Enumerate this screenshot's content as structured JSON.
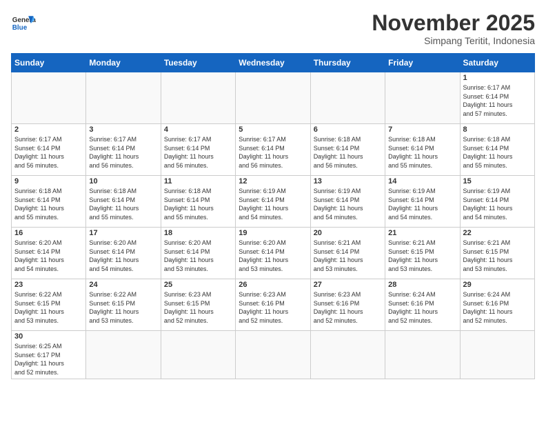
{
  "header": {
    "logo_general": "General",
    "logo_blue": "Blue",
    "month": "November 2025",
    "location": "Simpang Teritit, Indonesia"
  },
  "days_of_week": [
    "Sunday",
    "Monday",
    "Tuesday",
    "Wednesday",
    "Thursday",
    "Friday",
    "Saturday"
  ],
  "weeks": [
    [
      {
        "day": "",
        "info": ""
      },
      {
        "day": "",
        "info": ""
      },
      {
        "day": "",
        "info": ""
      },
      {
        "day": "",
        "info": ""
      },
      {
        "day": "",
        "info": ""
      },
      {
        "day": "",
        "info": ""
      },
      {
        "day": "1",
        "info": "Sunrise: 6:17 AM\nSunset: 6:14 PM\nDaylight: 11 hours\nand 57 minutes."
      }
    ],
    [
      {
        "day": "2",
        "info": "Sunrise: 6:17 AM\nSunset: 6:14 PM\nDaylight: 11 hours\nand 56 minutes."
      },
      {
        "day": "3",
        "info": "Sunrise: 6:17 AM\nSunset: 6:14 PM\nDaylight: 11 hours\nand 56 minutes."
      },
      {
        "day": "4",
        "info": "Sunrise: 6:17 AM\nSunset: 6:14 PM\nDaylight: 11 hours\nand 56 minutes."
      },
      {
        "day": "5",
        "info": "Sunrise: 6:17 AM\nSunset: 6:14 PM\nDaylight: 11 hours\nand 56 minutes."
      },
      {
        "day": "6",
        "info": "Sunrise: 6:18 AM\nSunset: 6:14 PM\nDaylight: 11 hours\nand 56 minutes."
      },
      {
        "day": "7",
        "info": "Sunrise: 6:18 AM\nSunset: 6:14 PM\nDaylight: 11 hours\nand 55 minutes."
      },
      {
        "day": "8",
        "info": "Sunrise: 6:18 AM\nSunset: 6:14 PM\nDaylight: 11 hours\nand 55 minutes."
      }
    ],
    [
      {
        "day": "9",
        "info": "Sunrise: 6:18 AM\nSunset: 6:14 PM\nDaylight: 11 hours\nand 55 minutes."
      },
      {
        "day": "10",
        "info": "Sunrise: 6:18 AM\nSunset: 6:14 PM\nDaylight: 11 hours\nand 55 minutes."
      },
      {
        "day": "11",
        "info": "Sunrise: 6:18 AM\nSunset: 6:14 PM\nDaylight: 11 hours\nand 55 minutes."
      },
      {
        "day": "12",
        "info": "Sunrise: 6:19 AM\nSunset: 6:14 PM\nDaylight: 11 hours\nand 54 minutes."
      },
      {
        "day": "13",
        "info": "Sunrise: 6:19 AM\nSunset: 6:14 PM\nDaylight: 11 hours\nand 54 minutes."
      },
      {
        "day": "14",
        "info": "Sunrise: 6:19 AM\nSunset: 6:14 PM\nDaylight: 11 hours\nand 54 minutes."
      },
      {
        "day": "15",
        "info": "Sunrise: 6:19 AM\nSunset: 6:14 PM\nDaylight: 11 hours\nand 54 minutes."
      }
    ],
    [
      {
        "day": "16",
        "info": "Sunrise: 6:20 AM\nSunset: 6:14 PM\nDaylight: 11 hours\nand 54 minutes."
      },
      {
        "day": "17",
        "info": "Sunrise: 6:20 AM\nSunset: 6:14 PM\nDaylight: 11 hours\nand 54 minutes."
      },
      {
        "day": "18",
        "info": "Sunrise: 6:20 AM\nSunset: 6:14 PM\nDaylight: 11 hours\nand 53 minutes."
      },
      {
        "day": "19",
        "info": "Sunrise: 6:20 AM\nSunset: 6:14 PM\nDaylight: 11 hours\nand 53 minutes."
      },
      {
        "day": "20",
        "info": "Sunrise: 6:21 AM\nSunset: 6:14 PM\nDaylight: 11 hours\nand 53 minutes."
      },
      {
        "day": "21",
        "info": "Sunrise: 6:21 AM\nSunset: 6:15 PM\nDaylight: 11 hours\nand 53 minutes."
      },
      {
        "day": "22",
        "info": "Sunrise: 6:21 AM\nSunset: 6:15 PM\nDaylight: 11 hours\nand 53 minutes."
      }
    ],
    [
      {
        "day": "23",
        "info": "Sunrise: 6:22 AM\nSunset: 6:15 PM\nDaylight: 11 hours\nand 53 minutes."
      },
      {
        "day": "24",
        "info": "Sunrise: 6:22 AM\nSunset: 6:15 PM\nDaylight: 11 hours\nand 53 minutes."
      },
      {
        "day": "25",
        "info": "Sunrise: 6:23 AM\nSunset: 6:15 PM\nDaylight: 11 hours\nand 52 minutes."
      },
      {
        "day": "26",
        "info": "Sunrise: 6:23 AM\nSunset: 6:16 PM\nDaylight: 11 hours\nand 52 minutes."
      },
      {
        "day": "27",
        "info": "Sunrise: 6:23 AM\nSunset: 6:16 PM\nDaylight: 11 hours\nand 52 minutes."
      },
      {
        "day": "28",
        "info": "Sunrise: 6:24 AM\nSunset: 6:16 PM\nDaylight: 11 hours\nand 52 minutes."
      },
      {
        "day": "29",
        "info": "Sunrise: 6:24 AM\nSunset: 6:16 PM\nDaylight: 11 hours\nand 52 minutes."
      }
    ],
    [
      {
        "day": "30",
        "info": "Sunrise: 6:25 AM\nSunset: 6:17 PM\nDaylight: 11 hours\nand 52 minutes."
      },
      {
        "day": "",
        "info": ""
      },
      {
        "day": "",
        "info": ""
      },
      {
        "day": "",
        "info": ""
      },
      {
        "day": "",
        "info": ""
      },
      {
        "day": "",
        "info": ""
      },
      {
        "day": "",
        "info": ""
      }
    ]
  ]
}
